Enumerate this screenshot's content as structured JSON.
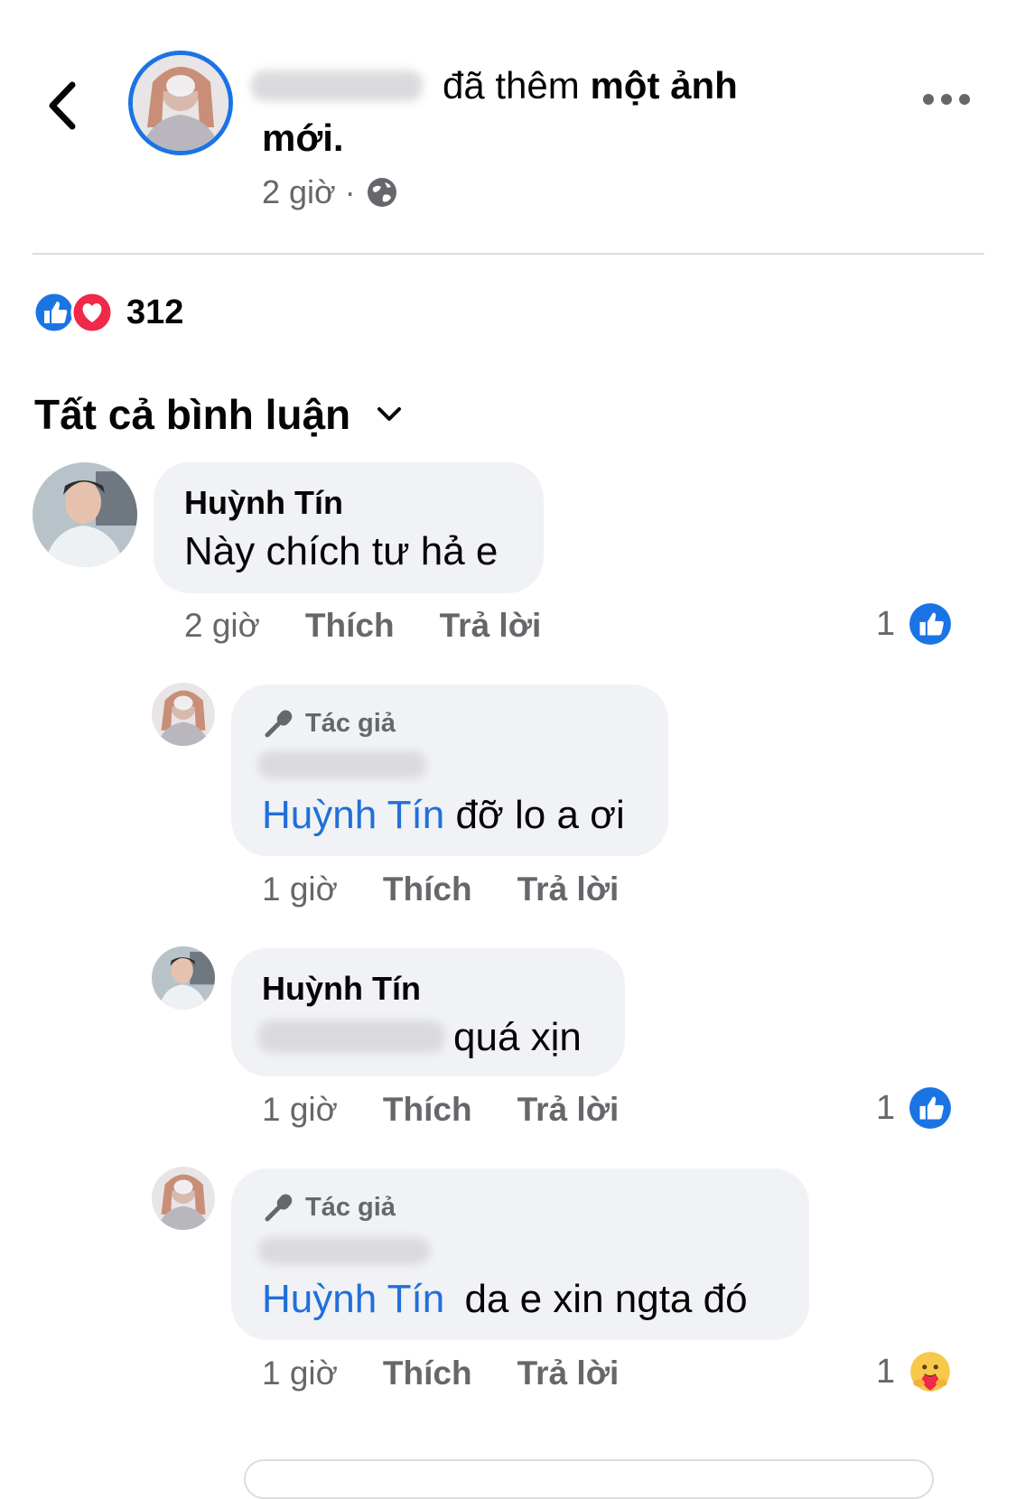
{
  "header": {
    "action_text": "đã thêm",
    "action_bold": "một ảnh mới.",
    "time": "2 giờ",
    "separator": "·"
  },
  "reactions": {
    "count": "312"
  },
  "comments_filter": {
    "label": "Tất cả bình luận"
  },
  "comments": [
    {
      "name": "Huỳnh Tín",
      "text": "Này chích tư hả e",
      "time": "2 giờ",
      "like_label": "Thích",
      "reply_label": "Trả lời",
      "reaction_count": "1"
    },
    {
      "badge": "Tác giả",
      "mention": "Huỳnh Tín",
      "text": "đỡ lo a ơi",
      "time": "1 giờ",
      "like_label": "Thích",
      "reply_label": "Trả lời"
    },
    {
      "name": "Huỳnh Tín",
      "text": "quá xịn",
      "time": "1 giờ",
      "like_label": "Thích",
      "reply_label": "Trả lời",
      "reaction_count": "1"
    },
    {
      "badge": "Tác giả",
      "mention": "Huỳnh Tín",
      "text": "da e xin ngta đó",
      "time": "1 giờ",
      "like_label": "Thích",
      "reply_label": "Trả lời",
      "reaction_count": "1"
    }
  ],
  "colors": {
    "brand_blue": "#1b74e4",
    "mention_blue": "#216fdb",
    "bubble_bg": "#f0f2f5",
    "secondary_text": "#65676b",
    "love_red": "#f02849"
  }
}
